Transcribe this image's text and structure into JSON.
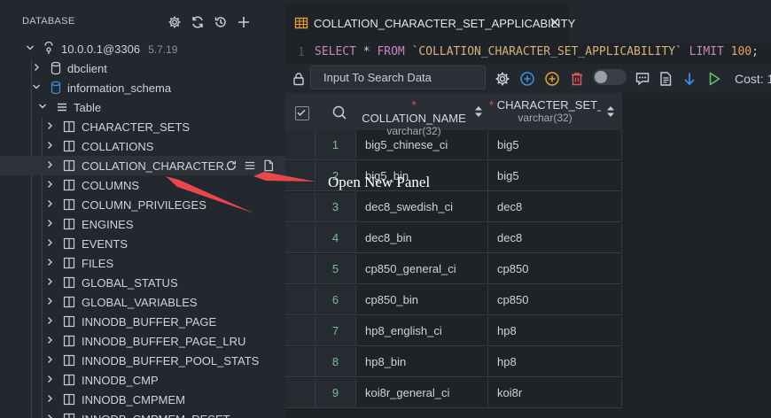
{
  "sidebar": {
    "title": "DATABASE",
    "header_icons": [
      "gear-icon",
      "refresh-icon",
      "history-icon",
      "add-icon"
    ],
    "connection": {
      "name": "10.0.0.1@3306",
      "version": "5.7.19"
    },
    "databases": [
      {
        "name": "dbclient"
      },
      {
        "name": "information_schema"
      }
    ],
    "table_group": "Table",
    "tables": [
      "CHARACTER_SETS",
      "COLLATIONS",
      "COLLATION_CHARACTER...",
      "COLUMNS",
      "COLUMN_PRIVILEGES",
      "ENGINES",
      "EVENTS",
      "FILES",
      "GLOBAL_STATUS",
      "GLOBAL_VARIABLES",
      "INNODB_BUFFER_PAGE",
      "INNODB_BUFFER_PAGE_LRU",
      "INNODB_BUFFER_POOL_STATS",
      "INNODB_CMP",
      "INNODB_CMPMEM",
      "INNODB_CMPMEM_RESET"
    ],
    "row_action_icons": [
      "refresh-icon",
      "list-icon",
      "new-file-icon"
    ]
  },
  "tab": {
    "label": "COLLATION_CHARACTER_SET_APPLICABILITY",
    "close": "×"
  },
  "editor": {
    "line_number": "1",
    "kw_select": "SELECT",
    "star": " * ",
    "kw_from": "FROM",
    "table": " `COLLATION_CHARACTER_SET_APPLICABILITY` ",
    "kw_limit": "LIMIT",
    "limit_value": " 100",
    "semicolon": ";"
  },
  "toolbar": {
    "search_placeholder": "Input To Search Data",
    "cost_label": "Cost: 1"
  },
  "grid": {
    "columns": [
      {
        "name": "COLLATION_NAME",
        "type": "varchar(32)",
        "required": "*"
      },
      {
        "name": "CHARACTER_SET_NA",
        "type": "varchar(32)",
        "required": "*"
      }
    ],
    "rows": [
      {
        "num": "1",
        "collation": "big5_chinese_ci",
        "charset": "big5"
      },
      {
        "num": "2",
        "collation": "big5_bin",
        "charset": "big5"
      },
      {
        "num": "3",
        "collation": "dec8_swedish_ci",
        "charset": "dec8"
      },
      {
        "num": "4",
        "collation": "dec8_bin",
        "charset": "dec8"
      },
      {
        "num": "5",
        "collation": "cp850_general_ci",
        "charset": "cp850"
      },
      {
        "num": "6",
        "collation": "cp850_bin",
        "charset": "cp850"
      },
      {
        "num": "7",
        "collation": "hp8_english_ci",
        "charset": "hp8"
      },
      {
        "num": "8",
        "collation": "hp8_bin",
        "charset": "hp8"
      },
      {
        "num": "9",
        "collation": "koi8r_general_ci",
        "charset": "koi8r"
      }
    ]
  },
  "annotation": {
    "text": "Open New Panel",
    "color": "#e8474c"
  },
  "colors": {
    "background": "#23272e",
    "accent_blue": "#3d8fe0",
    "accent_orange": "#e8a033",
    "accent_red": "#e0565b",
    "accent_green": "#5fc26e",
    "row_number": "#77c08f"
  }
}
